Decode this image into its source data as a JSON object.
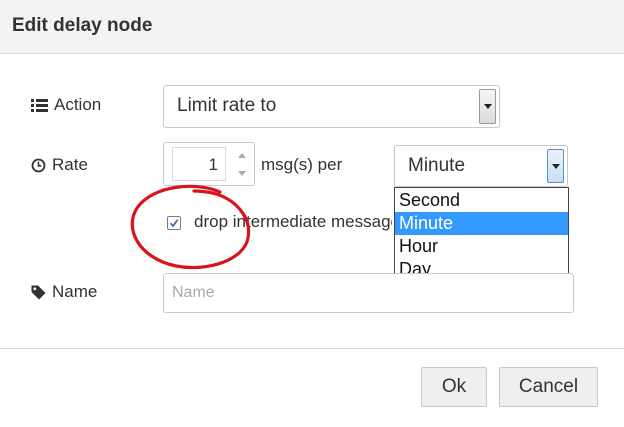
{
  "dialog": {
    "title": "Edit delay node"
  },
  "action": {
    "label": "Action",
    "icon": "list-icon",
    "selected": "Limit rate to"
  },
  "rate": {
    "label": "Rate",
    "icon": "clock-icon",
    "value": "1",
    "unit_text": "msg(s) per",
    "period_selected": "Minute",
    "period_options": [
      "Second",
      "Minute",
      "Hour",
      "Day"
    ],
    "highlighted_option": "Minute"
  },
  "drop": {
    "checked": true,
    "label": "drop intermediate messages"
  },
  "name": {
    "label": "Name",
    "icon": "tag-icon",
    "value": "",
    "placeholder": "Name"
  },
  "buttons": {
    "ok": "Ok",
    "cancel": "Cancel"
  },
  "colors": {
    "highlight": "#3399ff",
    "annotation_circle": "#d9141c",
    "titlebar": "#f3f3f3"
  }
}
